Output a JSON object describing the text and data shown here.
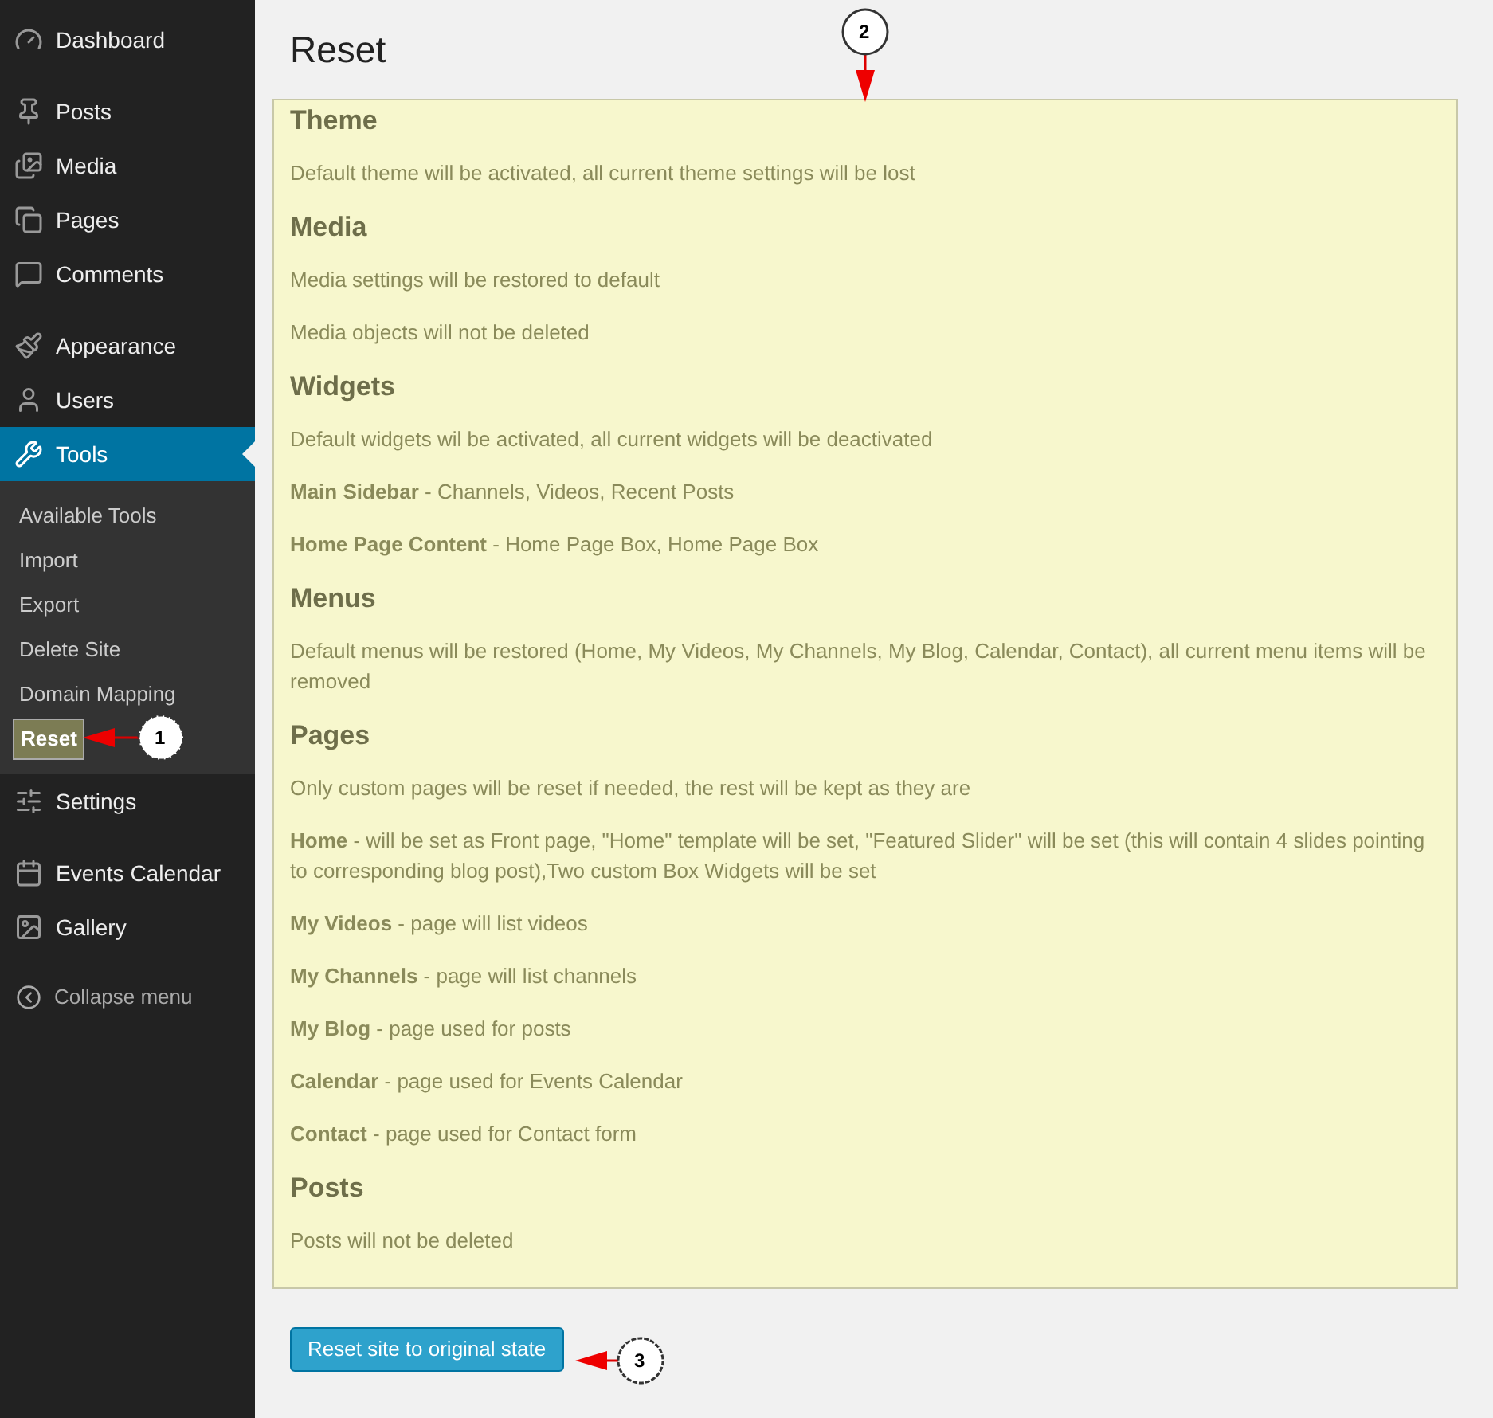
{
  "menu_groups": [
    {
      "items": [
        {
          "label": "Dashboard",
          "selected": false
        }
      ]
    },
    {
      "items": [
        {
          "label": "Posts",
          "selected": false
        },
        {
          "label": "Media",
          "selected": false
        },
        {
          "label": "Pages",
          "selected": false
        },
        {
          "label": "Comments",
          "selected": false
        }
      ]
    },
    {
      "items": [
        {
          "label": "Appearance",
          "selected": false
        },
        {
          "label": "Users",
          "selected": false
        },
        {
          "label": "Tools",
          "selected": true,
          "submenu": [
            {
              "label": "Available Tools",
              "selected": false
            },
            {
              "label": "Import",
              "selected": false
            },
            {
              "label": "Export",
              "selected": false
            },
            {
              "label": "Delete Site",
              "selected": false
            },
            {
              "label": "Domain Mapping",
              "selected": false
            },
            {
              "label": "Reset",
              "selected": true
            }
          ]
        },
        {
          "label": "Settings",
          "selected": false
        }
      ]
    },
    {
      "items": [
        {
          "label": "Events Calendar",
          "selected": false
        },
        {
          "label": "Gallery",
          "selected": false
        }
      ]
    }
  ],
  "collapse": "Collapse menu",
  "page_title": "Reset",
  "sections": [
    {
      "heading": "Theme",
      "paragraphs": [
        "Default theme will be activated, all current theme settings will be lost"
      ]
    },
    {
      "heading": "Media",
      "paragraphs": [
        "Media settings will be restored to default",
        "Media objects will not be deleted"
      ]
    },
    {
      "heading": "Widgets",
      "paragraphs": [
        "Default widgets wil be activated, all current widgets will be deactivated",
        "**Main Sidebar** - Channels, Videos, Recent Posts",
        "**Home Page Content** - Home Page Box, Home Page Box"
      ]
    },
    {
      "heading": "Menus",
      "paragraphs": [
        "Default menus will be restored (Home, My Videos, My Channels, My Blog, Calendar, Contact), all current menu items will be removed"
      ]
    },
    {
      "heading": "Pages",
      "paragraphs": [
        "Only custom pages will be reset if needed, the rest will be kept as they are",
        "**Home** - will be set as Front page, \"Home\" template will be set, \"Featured Slider\" will be set (this will contain 4 slides pointing to corresponding blog post),Two custom Box Widgets will be set",
        "**My Videos** - page will list videos",
        "**My Channels** - page will list channels",
        "**My Blog** - page used for posts",
        "**Calendar** - page used for Events Calendar",
        "**Contact** - page used for Contact form"
      ]
    },
    {
      "heading": "Posts",
      "paragraphs": [
        "Posts will not be deleted"
      ]
    }
  ],
  "reset_button": "Reset site to original state",
  "callouts": [
    "1",
    "2",
    "3"
  ]
}
